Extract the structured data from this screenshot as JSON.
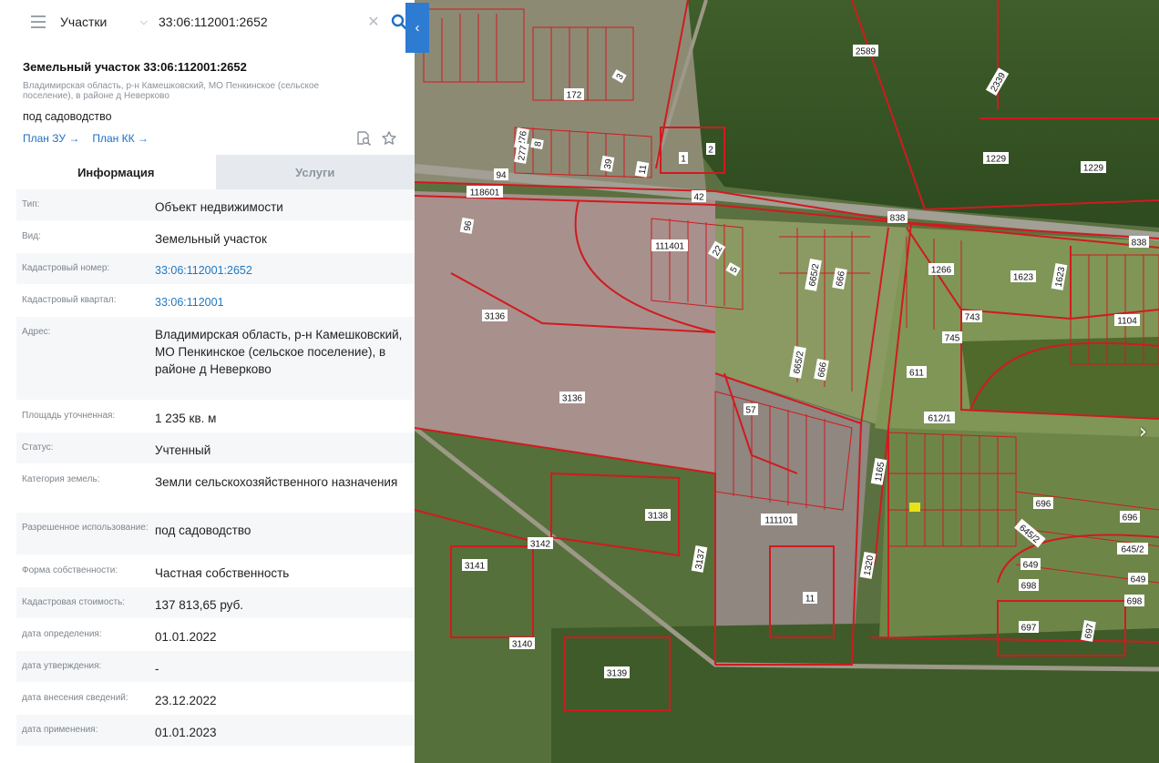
{
  "search": {
    "category": "Участки",
    "query": "33:06:112001:2652"
  },
  "object": {
    "title": "Земельный участок 33:06:112001:2652",
    "address": "Владимирская область, р-н Камешковский, МО Пенкинское (сельское поселение), в районе д Неверково",
    "use": "под садоводство",
    "link_zu": "План ЗУ →",
    "link_kk": "План КК →"
  },
  "tabs": {
    "info": "Информация",
    "services": "Услуги"
  },
  "rows": [
    {
      "k": "Тип:",
      "v": "Объект недвижимости"
    },
    {
      "k": "Вид:",
      "v": "Земельный участок"
    },
    {
      "k": "Кадастровый номер:",
      "v": "33:06:112001:2652"
    },
    {
      "k": "Кадастровый квартал:",
      "v": "33:06:112001"
    },
    {
      "k": "Адрес:",
      "v": "Владимирская область, р-н Камешковский, МО Пенкинское (сельское поселение), в районе д Неверково"
    },
    {
      "k": "Площадь уточненная:",
      "v": "1 235 кв. м"
    },
    {
      "k": "Статус:",
      "v": "Учтенный"
    },
    {
      "k": "Категория земель:",
      "v": "Земли сельскохозяйственного назначения"
    },
    {
      "k": "Разрешенное использование:",
      "v": "под садоводство"
    },
    {
      "k": "Форма собственности:",
      "v": "Частная собственность"
    },
    {
      "k": "Кадастровая стоимость:",
      "v": "137 813,65 руб."
    },
    {
      "k": "дата определения:",
      "v": "01.01.2022"
    },
    {
      "k": "дата утверждения:",
      "v": "-"
    },
    {
      "k": "дата внесения сведений:",
      "v": "23.12.2022"
    },
    {
      "k": "дата применения:",
      "v": "01.01.2023"
    }
  ],
  "map": {
    "labels": [
      "2589",
      "2339",
      "172",
      "3",
      "276",
      "8",
      "277",
      "39",
      "11",
      "1",
      "2",
      "1229",
      "1229",
      "94",
      "118601",
      "42",
      "838",
      "838",
      "96",
      "111401",
      "22",
      "5",
      "665/2",
      "666",
      "1266",
      "1623",
      "1623",
      "3136",
      "743",
      "745",
      "1104",
      "611",
      "3136",
      "665/2",
      "666",
      "57",
      "612/1",
      "1165",
      "696",
      "696",
      "645/2",
      "645/2",
      "3138",
      "111101",
      "3142",
      "3141",
      "3137",
      "1320",
      "649",
      "649",
      "698",
      "698",
      "11",
      "697",
      "697",
      "3140",
      "3139"
    ],
    "highlight_color": "#e8e21a",
    "boundary_color": "#d11a1f"
  },
  "colors": {
    "accent": "#2e7bd2",
    "link": "#1f78c1"
  },
  "icons": [
    "menu-icon",
    "chevron-down-icon",
    "clear-icon",
    "search-icon",
    "collapse-left-icon",
    "zoom-document-icon",
    "star-icon",
    "arrow-left-icon",
    "arrow-right-icon"
  ]
}
